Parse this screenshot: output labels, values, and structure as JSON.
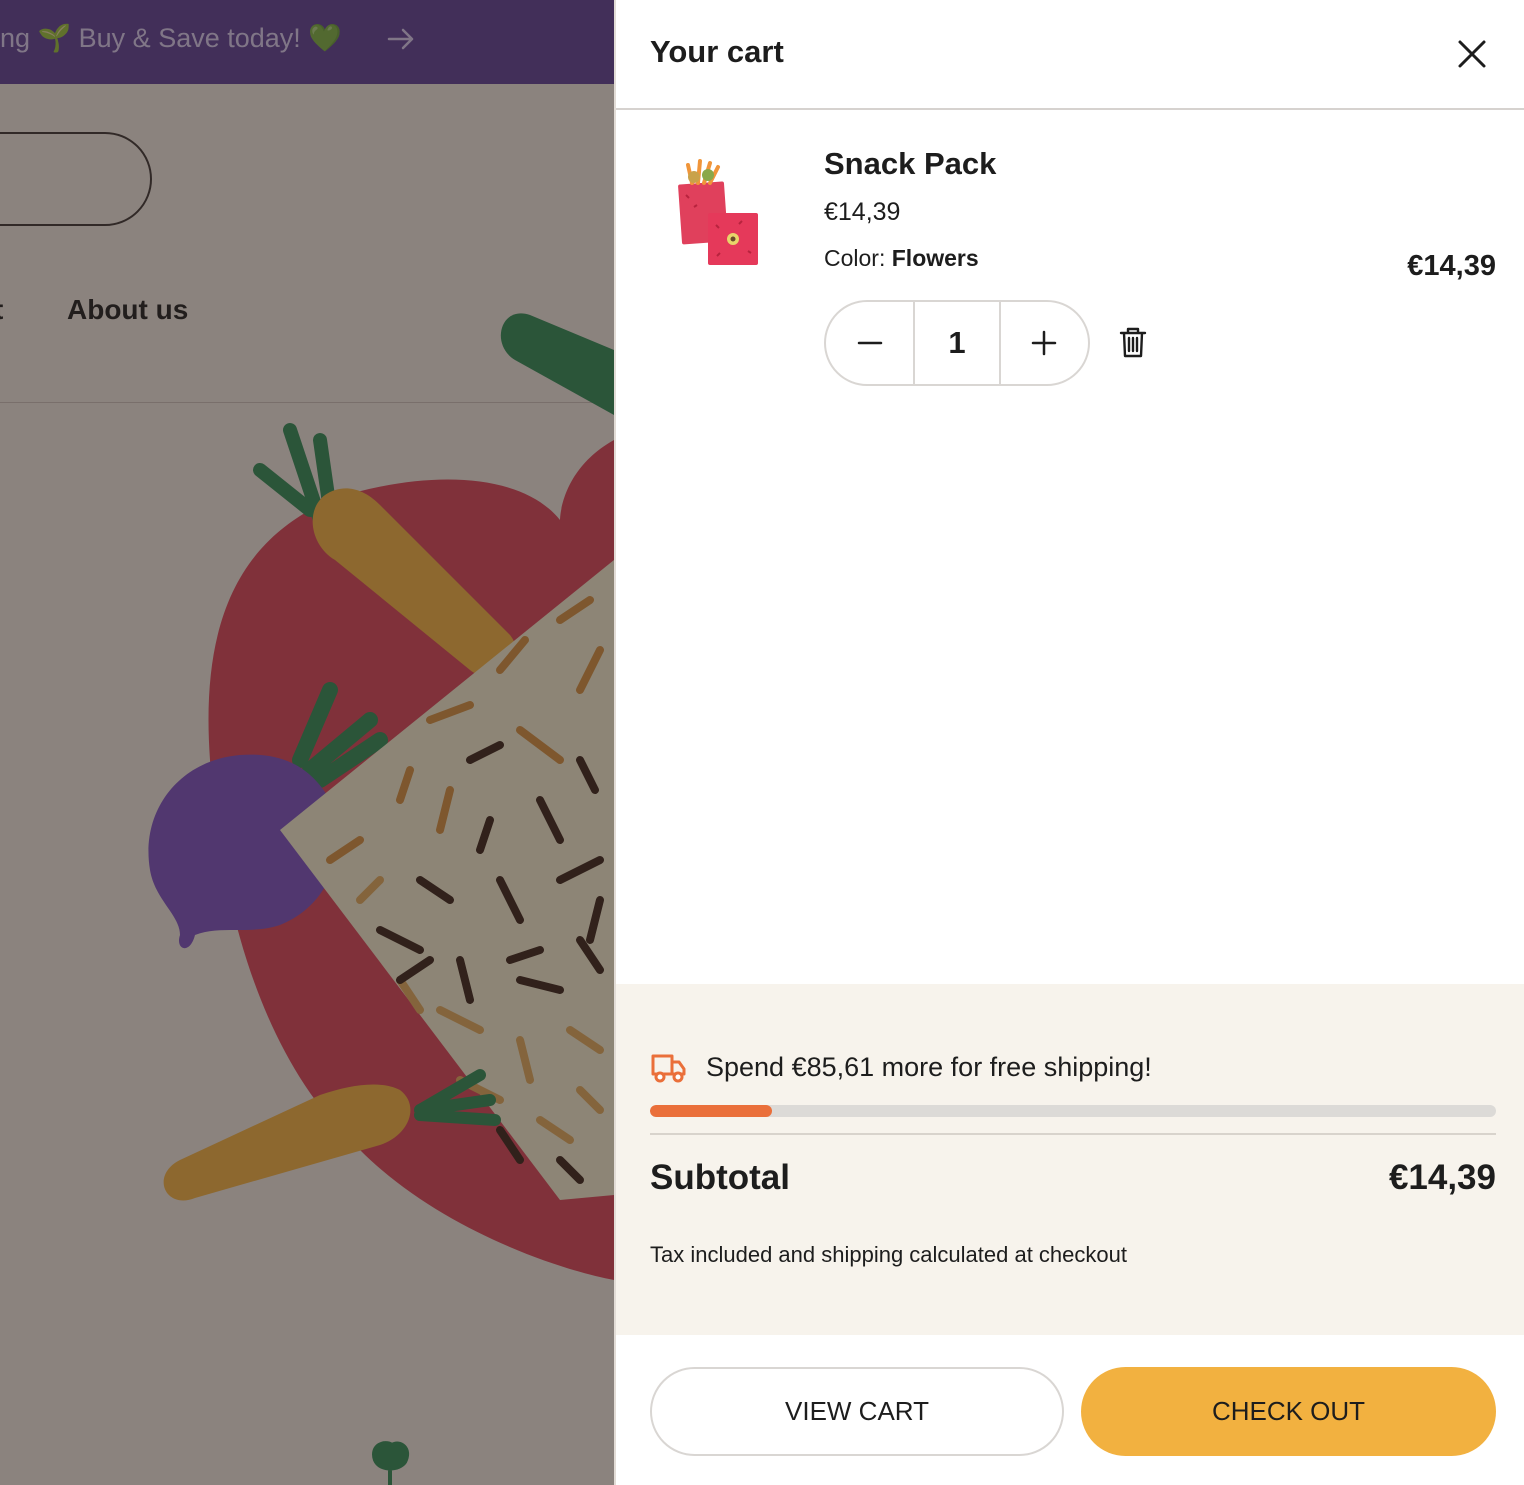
{
  "announcement": {
    "text": "ng 🌱 Buy & Save today! 💚"
  },
  "nav": {
    "partial_item": "t",
    "about_label": "About us"
  },
  "cart": {
    "title": "Your cart",
    "item": {
      "name": "Snack Pack",
      "unit_price": "€14,39",
      "variant_label": "Color:",
      "variant_value": "Flowers",
      "line_total": "€14,39",
      "quantity": "1"
    },
    "shipping": {
      "message": "Spend €85,61 more for free shipping!",
      "progress_fraction": 0.144
    },
    "subtotal_label": "Subtotal",
    "subtotal_value": "€14,39",
    "tax_note": "Tax included and shipping calculated at checkout",
    "view_cart_label": "VIEW CART",
    "checkout_label": "CHECK OUT"
  },
  "colors": {
    "announcement_bg": "#5d3f95",
    "checkout_button": "#f2b140",
    "progress_fill": "#ea6f3a",
    "summary_bg": "#f7f3ec"
  },
  "icons": {
    "close": "close-icon",
    "minus": "minus-icon",
    "plus": "plus-icon",
    "remove": "trash-icon",
    "shipping": "truck-icon",
    "announcement_arrow": "arrow-right-icon"
  }
}
